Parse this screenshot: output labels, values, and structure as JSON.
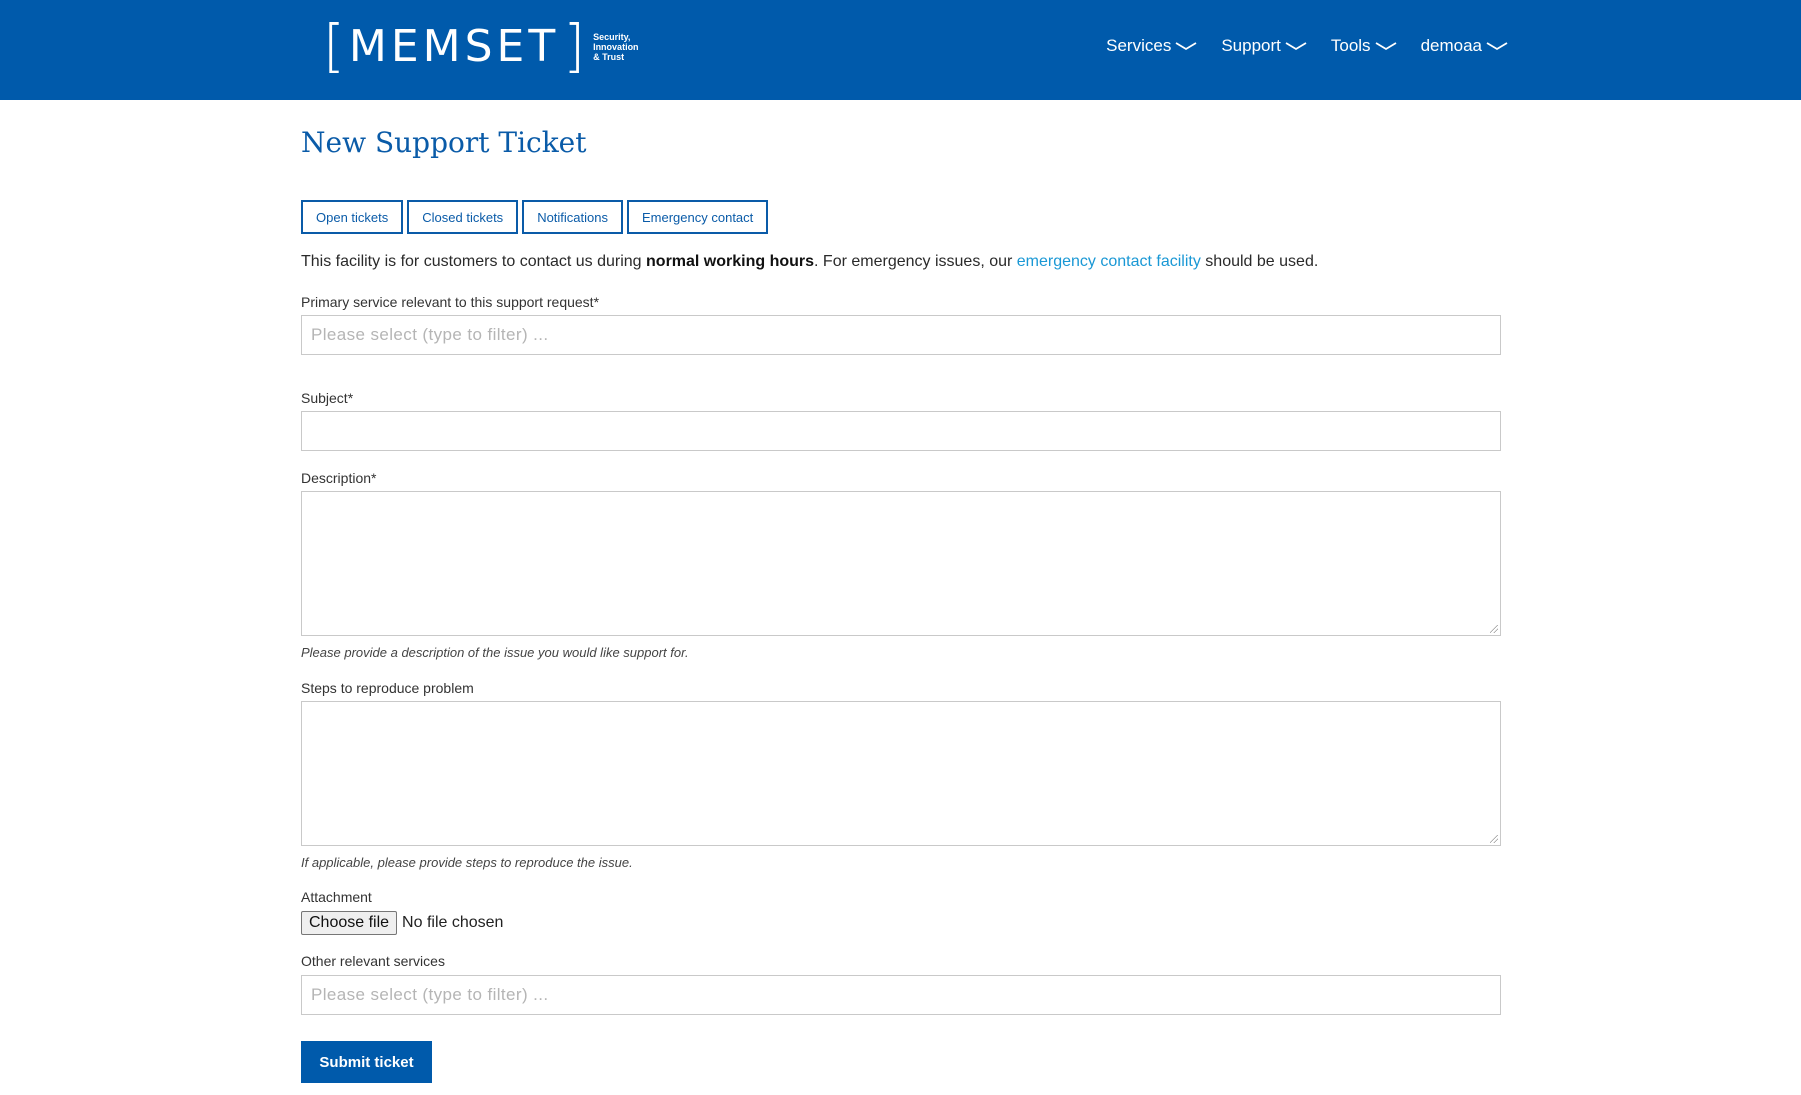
{
  "header": {
    "logo": {
      "word": "MEMSET",
      "tagline": [
        "Security,",
        "Innovation",
        "& Trust"
      ]
    },
    "nav": [
      {
        "label": "Services",
        "icon": "chevron-down-icon"
      },
      {
        "label": "Support",
        "icon": "chevron-down-icon"
      },
      {
        "label": "Tools",
        "icon": "chevron-down-icon"
      },
      {
        "label": "demoaa",
        "icon": "chevron-down-icon"
      }
    ]
  },
  "page": {
    "title": "New Support Ticket",
    "tabs": [
      "Open tickets",
      "Closed tickets",
      "Notifications",
      "Emergency contact"
    ],
    "intro": {
      "before": "This facility is for customers to contact us during ",
      "bold": "normal working hours",
      "middle": ". For emergency issues, our ",
      "link": "emergency contact facility",
      "after": " should be used."
    }
  },
  "form": {
    "primary_service": {
      "label": "Primary service relevant to this support request*",
      "placeholder": "Please select (type to filter) ..."
    },
    "subject": {
      "label": "Subject*",
      "value": ""
    },
    "description": {
      "label": "Description*",
      "value": "",
      "help": "Please provide a description of the issue you would like support for."
    },
    "steps": {
      "label": "Steps to reproduce problem",
      "value": "",
      "help": "If applicable, please provide steps to reproduce the issue."
    },
    "attachment": {
      "label": "Attachment",
      "button": "Choose file",
      "status": "No file chosen"
    },
    "other_services": {
      "label": "Other relevant services",
      "placeholder": "Please select (type to filter) ..."
    },
    "submit_label": "Submit ticket"
  },
  "colors": {
    "brand_blue": "#005aab",
    "link_blue": "#1a98d5",
    "title_blue": "#0a5ba8"
  }
}
